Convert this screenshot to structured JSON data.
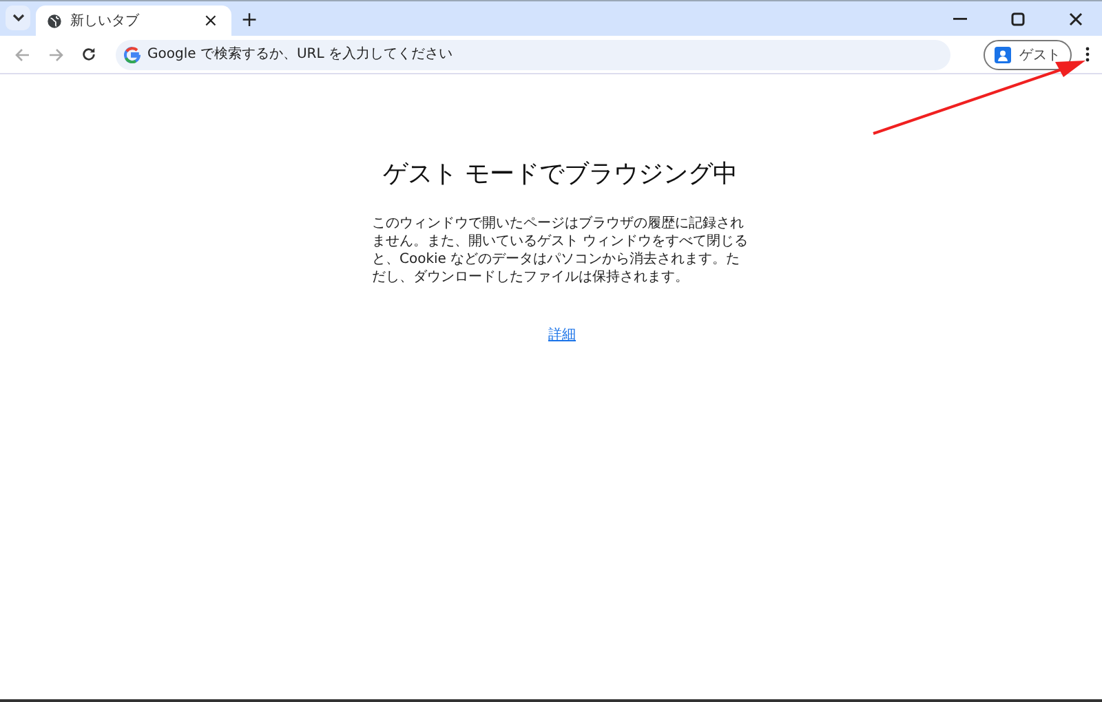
{
  "tabs": [
    {
      "title": "新しいタブ",
      "close": "×",
      "selected": true
    }
  ],
  "new_tab": "+",
  "address_bar": {
    "placeholder": "Google で検索するか、URL を入力してください"
  },
  "profile": {
    "label": "ゲスト"
  },
  "page": {
    "heading": "ゲスト モードでブラウジング中",
    "body": "このウィンドウで開いたページはブラウザの履歴に記録されません。また、開いているゲスト ウィンドウをすべて閉じると、Cookie などのデータはパソコンから消去されます。ただし、ダウンロードしたファイルは保持されます。",
    "link": "詳細"
  },
  "annotation": {
    "kind": "arrow"
  }
}
